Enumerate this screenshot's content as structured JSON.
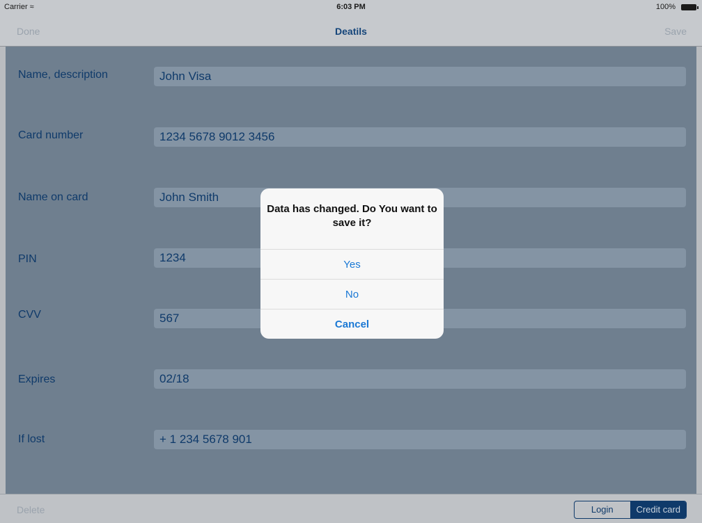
{
  "status_bar": {
    "carrier": "Carrier",
    "time": "6:03 PM",
    "battery": "100%"
  },
  "nav": {
    "done_label": "Done",
    "title": "Deatils",
    "save_label": "Save"
  },
  "fields": [
    {
      "label": "Name, description",
      "value": "John Visa"
    },
    {
      "label": "Card number",
      "value": "1234 5678 9012 3456"
    },
    {
      "label": "Name on card",
      "value": "John Smith"
    },
    {
      "label": "PIN",
      "value": "1234"
    },
    {
      "label": "CVV",
      "value": "567"
    },
    {
      "label": "Expires",
      "value": "02/18"
    },
    {
      "label": "If lost",
      "value": "+ 1 234 5678 901"
    }
  ],
  "toolbar": {
    "delete_label": "Delete",
    "segments": [
      "Login",
      "Credit card"
    ],
    "selected_segment": "Credit card"
  },
  "alert": {
    "message": "Data has changed. Do You want to save it?",
    "yes_label": "Yes",
    "no_label": "No",
    "cancel_label": "Cancel"
  },
  "colors": {
    "accent": "#0f3a6a",
    "alert_button": "#1a78d4",
    "dim_overlay": "#6f7f8f"
  }
}
